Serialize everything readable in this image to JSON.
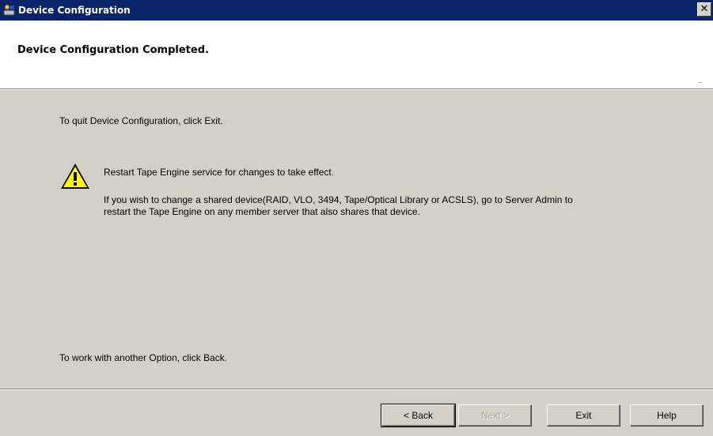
{
  "window": {
    "title": "Device Configuration",
    "close_glyph": "✕"
  },
  "header": {
    "title": "Device Configuration Completed."
  },
  "body": {
    "quit_instruction": "To quit Device Configuration, click Exit.",
    "warning": {
      "line1": "Restart Tape Engine service for changes to take effect.",
      "line2": "If you wish to change a shared device(RAID, VLO, 3494, Tape/Optical Library or ACSLS), go to Server Admin to",
      "line3": "restart the Tape Engine on any member server that also shares that device."
    },
    "back_instruction": "To work with another Option, click Back."
  },
  "buttons": {
    "back": "< Back",
    "next": "Next >",
    "exit": "Exit",
    "help": "Help"
  },
  "colors": {
    "titlebar": "#0a246a",
    "dialog_bg": "#d4d0c8",
    "header_bg": "#ffffff",
    "warning_yellow": "#ffff00"
  },
  "icons": {
    "app": "device-config-icon",
    "warning": "warning-icon",
    "close": "close-icon"
  }
}
